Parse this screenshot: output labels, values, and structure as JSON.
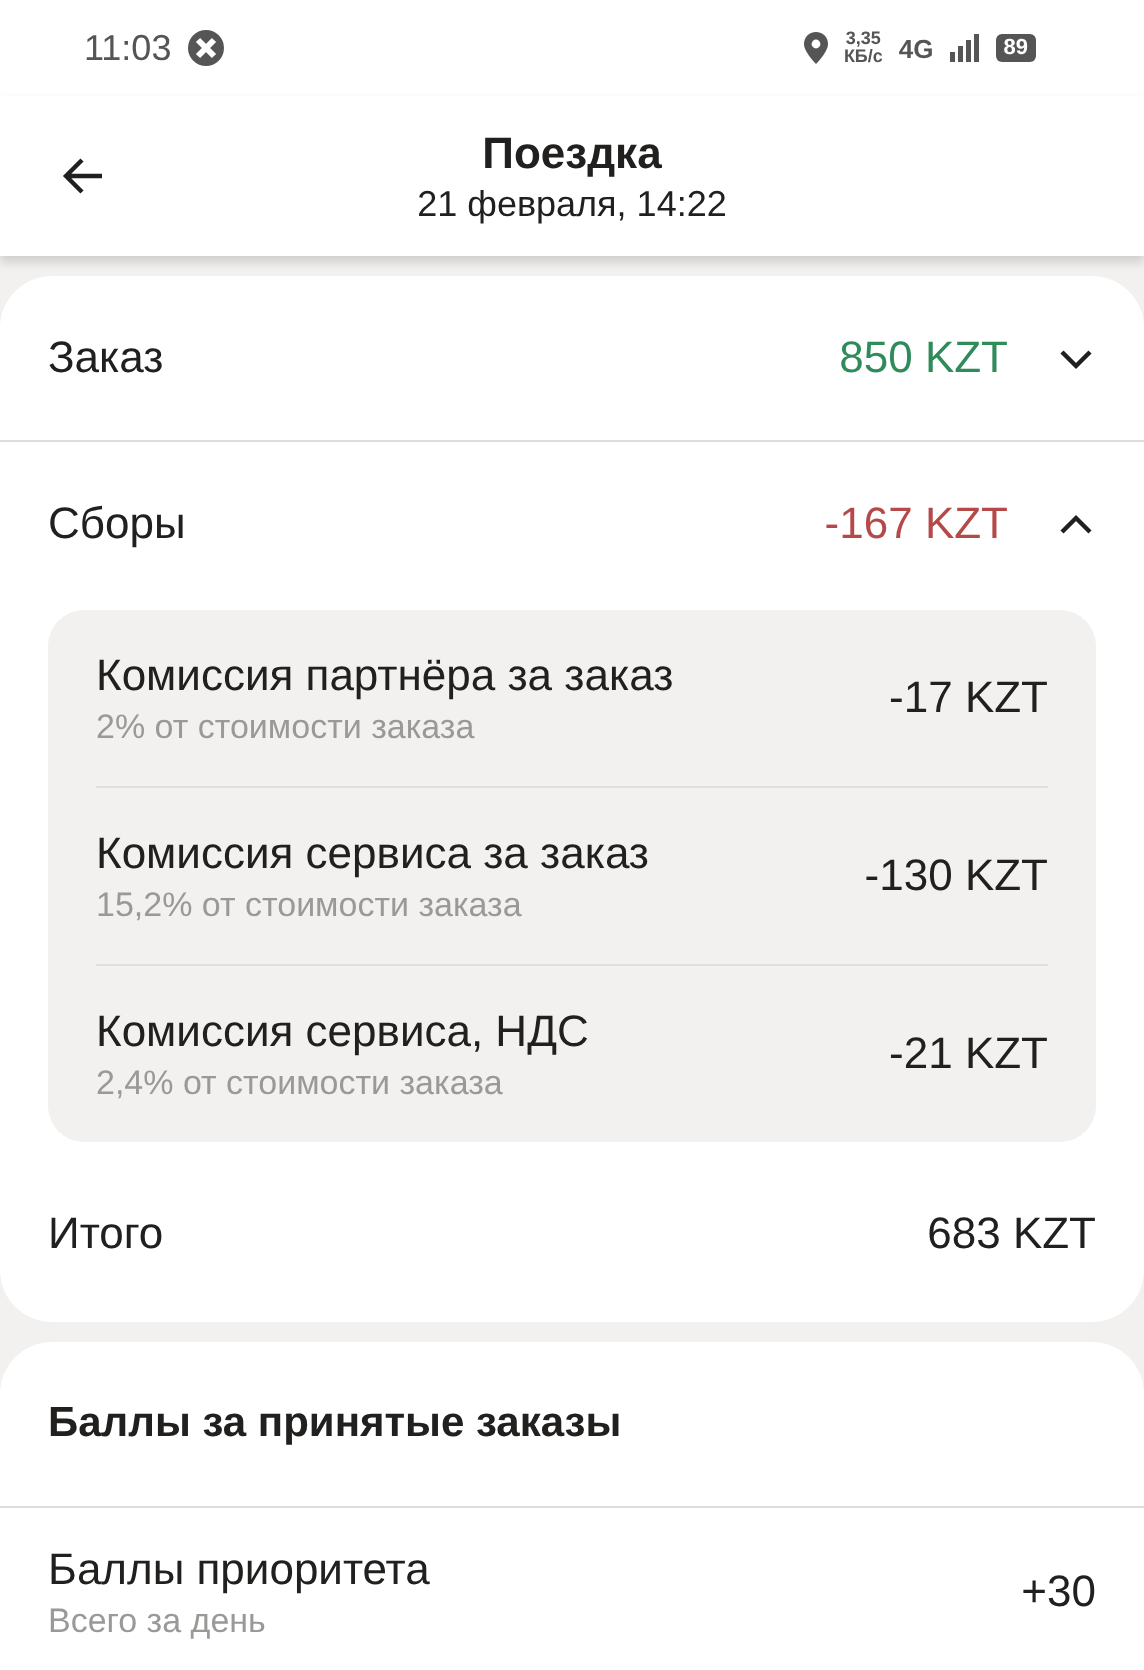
{
  "status_bar": {
    "time": "11:03",
    "speed_value": "3,35",
    "speed_unit": "КБ/с",
    "network": "4G",
    "battery": "89"
  },
  "header": {
    "title": "Поездка",
    "subtitle": "21 февраля, 14:22"
  },
  "fare": {
    "rows": [
      {
        "label": "Заказ",
        "amount": "850 KZT",
        "color": "#2e8b5a",
        "expanded": false
      },
      {
        "label": "Сборы",
        "amount": "-167 KZT",
        "color": "#b5494a",
        "expanded": true,
        "details": [
          {
            "label": "Комиссия партнёра за заказ",
            "note": "2% от стоимости заказа",
            "amount": "-17 KZT"
          },
          {
            "label": "Комиссия сервиса за заказ",
            "note": "15,2% от стоимости заказа",
            "amount": "-130 KZT"
          },
          {
            "label": "Комиссия сервиса, НДС",
            "note": "2,4% от стоимости заказа",
            "amount": "-21 KZT"
          }
        ]
      }
    ],
    "total": {
      "label": "Итого",
      "amount": "683 KZT"
    }
  },
  "points": {
    "title": "Баллы за принятые заказы",
    "rows": [
      {
        "label": "Баллы приоритета",
        "note": "Всего за день",
        "amount": "+30"
      }
    ]
  }
}
